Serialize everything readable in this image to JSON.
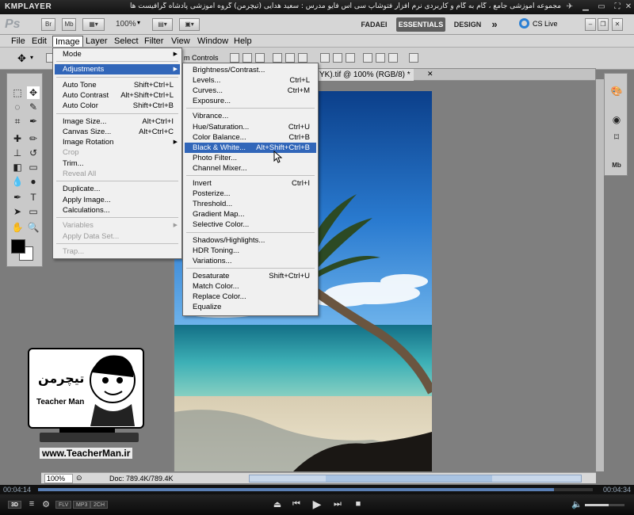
{
  "player": {
    "logo": "KMPLAYER",
    "caption": "مجموعه آموزشی جامع ، گام به گام و کاربردی نرم افزار فتوشاپ سی اس فایو  مدرس : سعید هدایی (تیچرمن) گروه آموزشی پادشاه گرافیست ها",
    "time_elapsed": "00:04:14",
    "time_total": "00:04:34",
    "progress_fraction": 0.93,
    "volume_fraction": 0.6,
    "tags": [
      "FLV",
      "MP3",
      "2CH"
    ],
    "mode_label": "3D"
  },
  "photoshop": {
    "logo": "Ps",
    "bridge_label": "Br",
    "minibridge_label": "Mb",
    "zoom_value": "100%",
    "workspaces": [
      "FADAEI",
      "ESSENTIALS",
      "DESIGN"
    ],
    "more_workspaces": "»",
    "cs_live": "CS Live",
    "menus": [
      "File",
      "Edit",
      "Image",
      "Layer",
      "Select",
      "Filter",
      "View",
      "Window",
      "Help"
    ],
    "options_label": "m Controls",
    "document_tab": "YK).tif @ 100% (RGB/8) *",
    "status": {
      "zoom": "100%",
      "doc": "Doc: 789.4K/789.4K"
    }
  },
  "image_menu": [
    {
      "label": "Mode",
      "shortcut": "",
      "submenu": true,
      "disabled": false
    },
    {
      "sep": true
    },
    {
      "label": "Adjustments",
      "shortcut": "",
      "submenu": true,
      "disabled": false,
      "highlight": true
    },
    {
      "sep": true
    },
    {
      "label": "Auto Tone",
      "shortcut": "Shift+Ctrl+L",
      "disabled": false
    },
    {
      "label": "Auto Contrast",
      "shortcut": "Alt+Shift+Ctrl+L",
      "disabled": false
    },
    {
      "label": "Auto Color",
      "shortcut": "Shift+Ctrl+B",
      "disabled": false
    },
    {
      "sep": true
    },
    {
      "label": "Image Size...",
      "shortcut": "Alt+Ctrl+I",
      "disabled": false
    },
    {
      "label": "Canvas Size...",
      "shortcut": "Alt+Ctrl+C",
      "disabled": false
    },
    {
      "label": "Image Rotation",
      "shortcut": "",
      "submenu": true,
      "disabled": false
    },
    {
      "label": "Crop",
      "shortcut": "",
      "disabled": true
    },
    {
      "label": "Trim...",
      "shortcut": "",
      "disabled": false
    },
    {
      "label": "Reveal All",
      "shortcut": "",
      "disabled": true
    },
    {
      "sep": true
    },
    {
      "label": "Duplicate...",
      "shortcut": "",
      "disabled": false
    },
    {
      "label": "Apply Image...",
      "shortcut": "",
      "disabled": false
    },
    {
      "label": "Calculations...",
      "shortcut": "",
      "disabled": false
    },
    {
      "sep": true
    },
    {
      "label": "Variables",
      "shortcut": "",
      "submenu": true,
      "disabled": true
    },
    {
      "label": "Apply Data Set...",
      "shortcut": "",
      "disabled": true
    },
    {
      "sep": true
    },
    {
      "label": "Trap...",
      "shortcut": "",
      "disabled": true
    }
  ],
  "adjustments_menu": [
    {
      "label": "Brightness/Contrast...",
      "shortcut": ""
    },
    {
      "label": "Levels...",
      "shortcut": "Ctrl+L"
    },
    {
      "label": "Curves...",
      "shortcut": "Ctrl+M"
    },
    {
      "label": "Exposure...",
      "shortcut": ""
    },
    {
      "sep": true
    },
    {
      "label": "Vibrance...",
      "shortcut": ""
    },
    {
      "label": "Hue/Saturation...",
      "shortcut": "Ctrl+U"
    },
    {
      "label": "Color Balance...",
      "shortcut": "Ctrl+B"
    },
    {
      "label": "Black & White...",
      "shortcut": "Alt+Shift+Ctrl+B",
      "highlight": true
    },
    {
      "label": "Photo Filter...",
      "shortcut": ""
    },
    {
      "label": "Channel Mixer...",
      "shortcut": ""
    },
    {
      "sep": true
    },
    {
      "label": "Invert",
      "shortcut": "Ctrl+I"
    },
    {
      "label": "Posterize...",
      "shortcut": ""
    },
    {
      "label": "Threshold...",
      "shortcut": ""
    },
    {
      "label": "Gradient Map...",
      "shortcut": ""
    },
    {
      "label": "Selective Color...",
      "shortcut": ""
    },
    {
      "sep": true
    },
    {
      "label": "Shadows/Highlights...",
      "shortcut": ""
    },
    {
      "label": "HDR Toning...",
      "shortcut": ""
    },
    {
      "label": "Variations...",
      "shortcut": ""
    },
    {
      "sep": true
    },
    {
      "label": "Desaturate",
      "shortcut": "Shift+Ctrl+U"
    },
    {
      "label": "Match Color...",
      "shortcut": ""
    },
    {
      "label": "Replace Color...",
      "shortcut": ""
    },
    {
      "label": "Equalize",
      "shortcut": ""
    }
  ],
  "watermark": {
    "name_fa": "تیچرمن",
    "name_en": "Teacher Man",
    "url": "www.TeacherMan.ir"
  },
  "colors": {
    "highlight": "#3166b9",
    "menu_bg": "#f0f0f0",
    "ps_panel": "#c9c9c9"
  }
}
